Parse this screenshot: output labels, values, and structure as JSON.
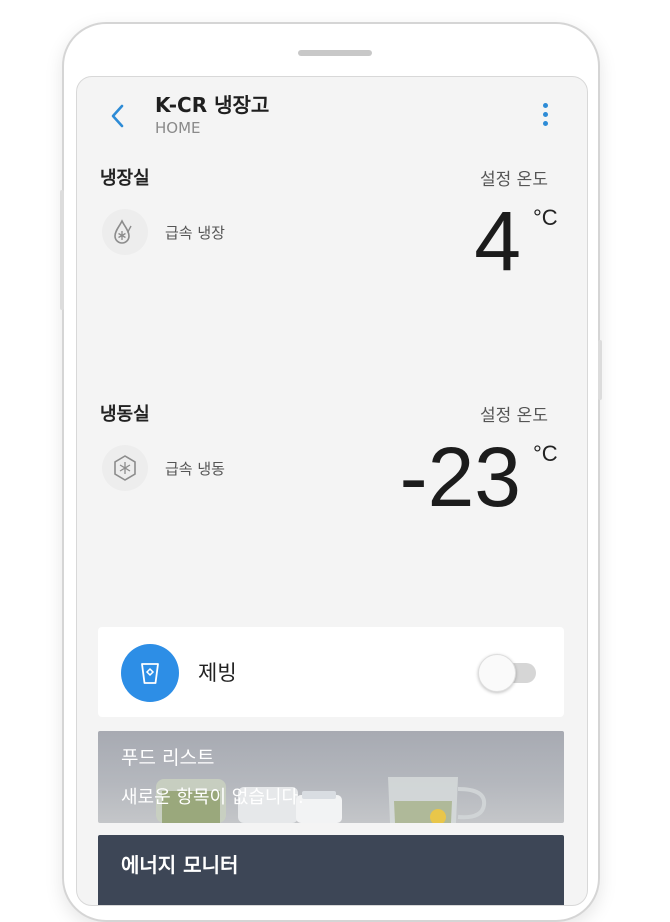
{
  "header": {
    "title": "K-CR 냉장고",
    "subtitle": "HOME"
  },
  "fridge": {
    "title": "냉장실",
    "set_label": "설정 온도",
    "mode_label": "급속 냉장",
    "temperature": "4",
    "unit": "°C"
  },
  "freezer": {
    "title": "냉동실",
    "set_label": "설정 온도",
    "mode_label": "급속 냉동",
    "temperature": "-23",
    "unit": "°C"
  },
  "ice_maker": {
    "label": "제빙",
    "enabled": false
  },
  "food_list": {
    "title": "푸드 리스트",
    "subtitle": "새로운 항목이 없습니다."
  },
  "energy_monitor": {
    "title": "에너지 모니터"
  },
  "colors": {
    "accent": "#2d8ee6",
    "energy_card": "#3d4656",
    "screen_bg": "#f4f4f4"
  }
}
